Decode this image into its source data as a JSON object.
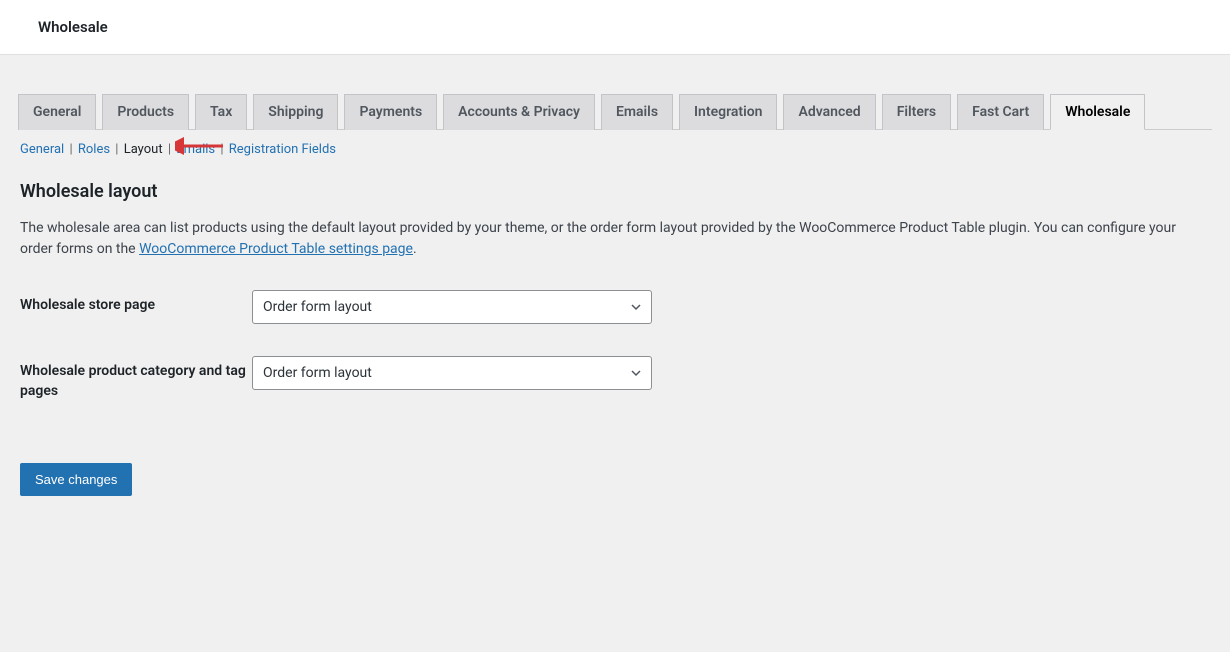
{
  "header": {
    "title": "Wholesale"
  },
  "tabs": [
    {
      "label": "General"
    },
    {
      "label": "Products"
    },
    {
      "label": "Tax"
    },
    {
      "label": "Shipping"
    },
    {
      "label": "Payments"
    },
    {
      "label": "Accounts & Privacy"
    },
    {
      "label": "Emails"
    },
    {
      "label": "Integration"
    },
    {
      "label": "Advanced"
    },
    {
      "label": "Filters"
    },
    {
      "label": "Fast Cart"
    },
    {
      "label": "Wholesale",
      "active": true
    }
  ],
  "subnav": {
    "items": [
      {
        "label": "General",
        "current": false
      },
      {
        "label": "Roles",
        "current": false
      },
      {
        "label": "Layout",
        "current": true
      },
      {
        "label": "Emails",
        "current": false
      },
      {
        "label": "Registration Fields",
        "current": false
      }
    ]
  },
  "page": {
    "title": "Wholesale layout",
    "desc_pre": "The wholesale area can list products using the default layout provided by your theme, or the order form layout provided by the WooCommerce Product Table plugin. You can configure your order forms on the ",
    "desc_link": "WooCommerce Product Table settings page",
    "desc_post": "."
  },
  "fields": {
    "store_page": {
      "label": "Wholesale store page",
      "value": "Order form layout"
    },
    "cat_tag_pages": {
      "label": "Wholesale product category and tag pages",
      "value": "Order form layout"
    }
  },
  "buttons": {
    "save": "Save changes"
  }
}
